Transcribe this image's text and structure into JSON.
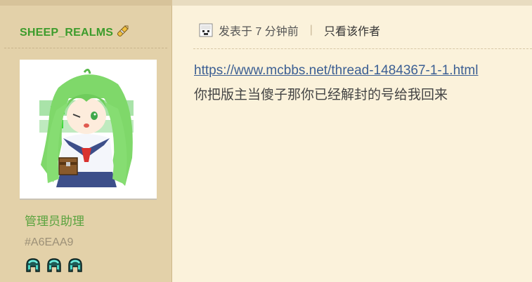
{
  "author": {
    "name": "SHEEP_REALMS",
    "badge_icon": "pencil-badge-icon",
    "group": "管理员助理",
    "uid_color_code": "#A6EAA9",
    "medals": [
      "diamond-helmet-icon",
      "diamond-helmet-icon",
      "diamond-helmet-icon"
    ]
  },
  "post": {
    "posted_label": "发表于 7 分钟前",
    "separator": "|",
    "only_author_label": "只看该作者",
    "link_text": "https://www.mcbbs.net/thread-1484367-1-1.html",
    "body_text": "你把版主当傻子那你已经解封的号给我回来"
  },
  "colors": {
    "username": "#3d9c2c",
    "group": "#5aa33f",
    "link": "#3c5f93",
    "sidebar_bg": "#e3d1a9",
    "post_bg": "#fbf2db"
  }
}
